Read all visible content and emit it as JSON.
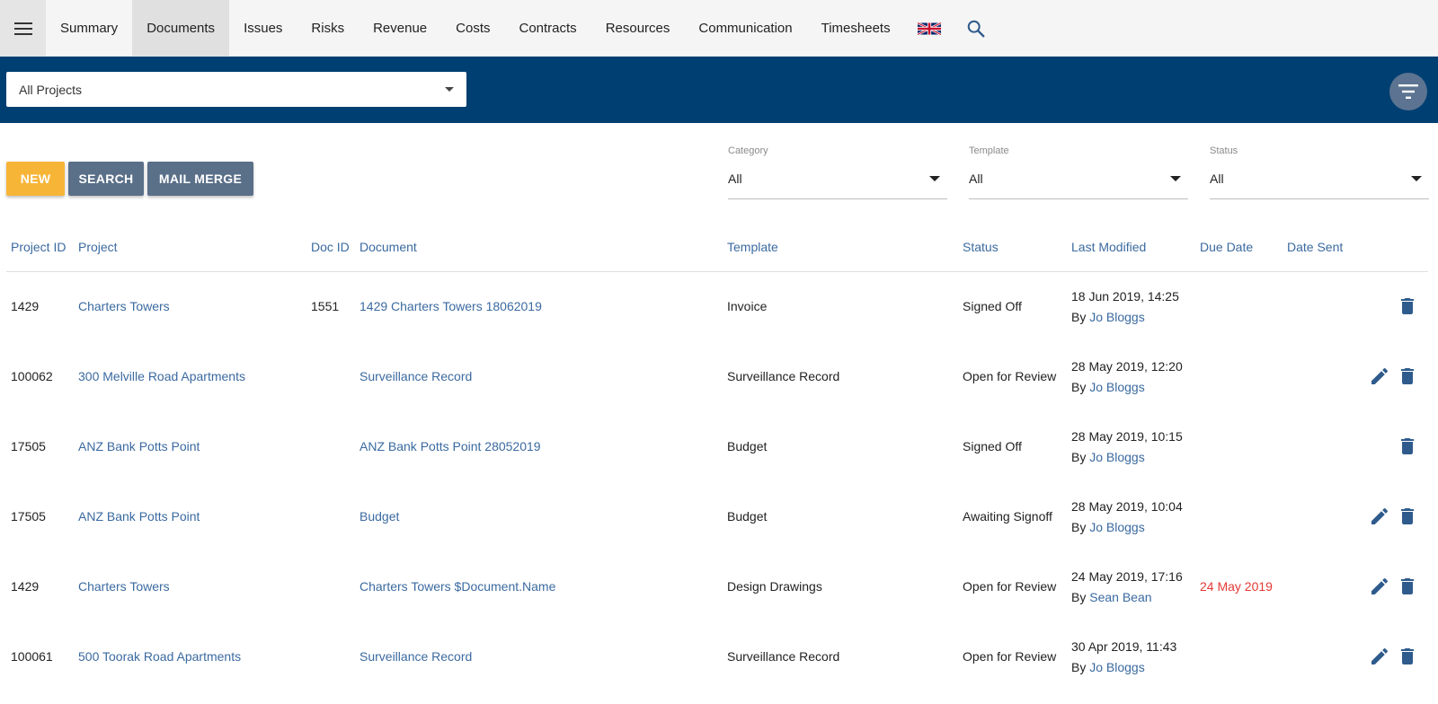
{
  "nav": {
    "tabs": [
      {
        "label": "Summary"
      },
      {
        "label": "Documents",
        "active": true
      },
      {
        "label": "Issues"
      },
      {
        "label": "Risks"
      },
      {
        "label": "Revenue"
      },
      {
        "label": "Costs"
      },
      {
        "label": "Contracts"
      },
      {
        "label": "Resources"
      },
      {
        "label": "Communication"
      },
      {
        "label": "Timesheets"
      }
    ],
    "icons": [
      "menu-icon",
      "uk-flag-icon",
      "search-icon"
    ]
  },
  "project_select": {
    "value": "All Projects"
  },
  "buttons": {
    "new": "NEW",
    "search": "SEARCH",
    "mail_merge": "MAIL MERGE"
  },
  "filters": {
    "category": {
      "label": "Category",
      "value": "All"
    },
    "template": {
      "label": "Template",
      "value": "All"
    },
    "status": {
      "label": "Status",
      "value": "All"
    }
  },
  "table": {
    "headers": {
      "project_id": "Project ID",
      "project": "Project",
      "doc_id": "Doc ID",
      "document": "Document",
      "template": "Template",
      "status": "Status",
      "last_modified": "Last Modified",
      "due_date": "Due Date",
      "date_sent": "Date Sent"
    },
    "rows": [
      {
        "project_id": "1429",
        "project": "Charters Towers",
        "doc_id": "1551",
        "document": "1429 Charters Towers 18062019",
        "template": "Invoice",
        "status": "Signed Off",
        "modified": "18 Jun 2019, 14:25",
        "by": "By",
        "user": "Jo Bloggs",
        "due": "",
        "sent": "",
        "editable": false
      },
      {
        "project_id": "100062",
        "project": "300 Melville Road Apartments",
        "doc_id": "",
        "document": "Surveillance Record",
        "template": "Surveillance Record",
        "status": "Open for Review",
        "modified": "28 May 2019, 12:20",
        "by": "By",
        "user": "Jo Bloggs",
        "due": "",
        "sent": "",
        "editable": true
      },
      {
        "project_id": "17505",
        "project": "ANZ Bank Potts Point",
        "doc_id": "",
        "document": "ANZ Bank Potts Point 28052019",
        "template": "Budget",
        "status": "Signed Off",
        "modified": "28 May 2019, 10:15",
        "by": "By",
        "user": "Jo Bloggs",
        "due": "",
        "sent": "",
        "editable": false
      },
      {
        "project_id": "17505",
        "project": "ANZ Bank Potts Point",
        "doc_id": "",
        "document": "Budget",
        "template": "Budget",
        "status": "Awaiting Signoff",
        "modified": "28 May 2019, 10:04",
        "by": "By",
        "user": "Jo Bloggs",
        "due": "",
        "sent": "",
        "editable": true
      },
      {
        "project_id": "1429",
        "project": "Charters Towers",
        "doc_id": "",
        "document": "Charters Towers $Document.Name",
        "template": "Design Drawings",
        "status": "Open for Review",
        "modified": "24 May 2019, 17:16",
        "by": "By",
        "user": "Sean Bean",
        "due": "24 May 2019",
        "sent": "",
        "editable": true
      },
      {
        "project_id": "100061",
        "project": "500 Toorak Road Apartments",
        "doc_id": "",
        "document": "Surveillance Record",
        "template": "Surveillance Record",
        "status": "Open for Review",
        "modified": "30 Apr 2019, 11:43",
        "by": "By",
        "user": "Jo Bloggs",
        "due": "",
        "sent": "",
        "editable": true
      }
    ]
  },
  "colors": {
    "header_blue": "#003f72",
    "new_button": "#f7b538",
    "secondary_button": "#5a6f88",
    "link": "#3b6aa0",
    "overdue": "#e53935",
    "action_icon": "#2f5b8c"
  }
}
